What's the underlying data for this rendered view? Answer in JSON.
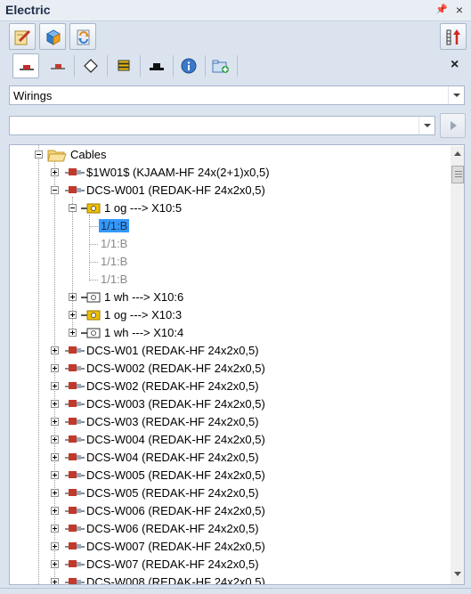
{
  "window": {
    "title": "Electric",
    "pin_icon": "pin-icon",
    "close_icon": "close-icon"
  },
  "toolbar": {
    "buttons": [
      "edit-icon",
      "3d-box-icon",
      "refresh-icon"
    ],
    "right_button": "sort-icon"
  },
  "tabs": {
    "items": [
      "wire-icon",
      "cable-icon",
      "diamond-icon",
      "stack-icon",
      "connector-icon",
      "info-icon",
      "add-folder-icon"
    ],
    "active_index": 0,
    "close_label": "×"
  },
  "view_selector": {
    "value": "Wirings"
  },
  "search": {
    "value": "",
    "placeholder": ""
  },
  "tree": {
    "root": {
      "label": "Cables"
    },
    "rows": [
      {
        "label": "$1W01$  (KJAAM-HF 24x(2+1)x0,5)"
      },
      {
        "label": "DCS-W001  (REDAK-HF 24x2x0,5)"
      },
      {
        "label": "1 og      ---> X10:5"
      },
      {
        "label": "1/1:B"
      },
      {
        "label": "1/1:B"
      },
      {
        "label": "1/1:B"
      },
      {
        "label": "1/1:B"
      },
      {
        "label": "1 wh      ---> X10:6"
      },
      {
        "label": "1 og      ---> X10:3"
      },
      {
        "label": "1 wh      ---> X10:4"
      },
      {
        "label": "DCS-W01  (REDAK-HF 24x2x0,5)"
      },
      {
        "label": "DCS-W002  (REDAK-HF 24x2x0,5)"
      },
      {
        "label": "DCS-W02  (REDAK-HF 24x2x0,5)"
      },
      {
        "label": "DCS-W003  (REDAK-HF 24x2x0,5)"
      },
      {
        "label": "DCS-W03  (REDAK-HF 24x2x0,5)"
      },
      {
        "label": "DCS-W004  (REDAK-HF 24x2x0,5)"
      },
      {
        "label": "DCS-W04  (REDAK-HF 24x2x0,5)"
      },
      {
        "label": "DCS-W005  (REDAK-HF 24x2x0,5)"
      },
      {
        "label": "DCS-W05  (REDAK-HF 24x2x0,5)"
      },
      {
        "label": "DCS-W006  (REDAK-HF 24x2x0,5)"
      },
      {
        "label": "DCS-W06  (REDAK-HF 24x2x0,5)"
      },
      {
        "label": "DCS-W007  (REDAK-HF 24x2x0,5)"
      },
      {
        "label": "DCS-W07  (REDAK-HF 24x2x0,5)"
      },
      {
        "label": "DCS-W008  (REDAK-HF 24x2x0,5)"
      }
    ]
  },
  "colors": {
    "selection": "#3399ff",
    "panel": "#dbe3ee",
    "connector": "#f0c000"
  }
}
